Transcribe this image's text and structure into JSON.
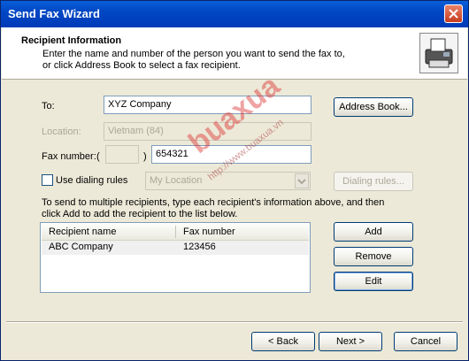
{
  "window": {
    "title": "Send Fax Wizard"
  },
  "header": {
    "title": "Recipient Information",
    "subtitle_line1": "Enter the name and number of the person you want to send the fax to,",
    "subtitle_line2": "or click Address Book to select a fax recipient."
  },
  "form": {
    "to_label": "To:",
    "to_value": "XYZ Company",
    "location_label": "Location:",
    "location_value": "Vietnam (84)",
    "fax_label": "Fax number:",
    "paren_open": "(",
    "paren_close": ")",
    "area_code": "",
    "fax_value": "654321",
    "dialing_label": "Use dialing rules",
    "dialing_location": "My Location"
  },
  "buttons": {
    "address_book": "Address Book...",
    "dialing_rules": "Dialing rules...",
    "add": "Add",
    "remove": "Remove",
    "edit": "Edit",
    "back": "< Back",
    "next": "Next >",
    "cancel": "Cancel"
  },
  "instructions": {
    "line1": "To send to multiple recipients, type each recipient's information above, and then",
    "line2": "click Add to add the recipient to the list below."
  },
  "list": {
    "columns": [
      "Recipient name",
      "Fax number"
    ],
    "rows": [
      {
        "name": "ABC Company",
        "fax": "123456"
      }
    ]
  },
  "watermark": {
    "main": "buaxua",
    "url": "http://www.buaxua.vn"
  }
}
